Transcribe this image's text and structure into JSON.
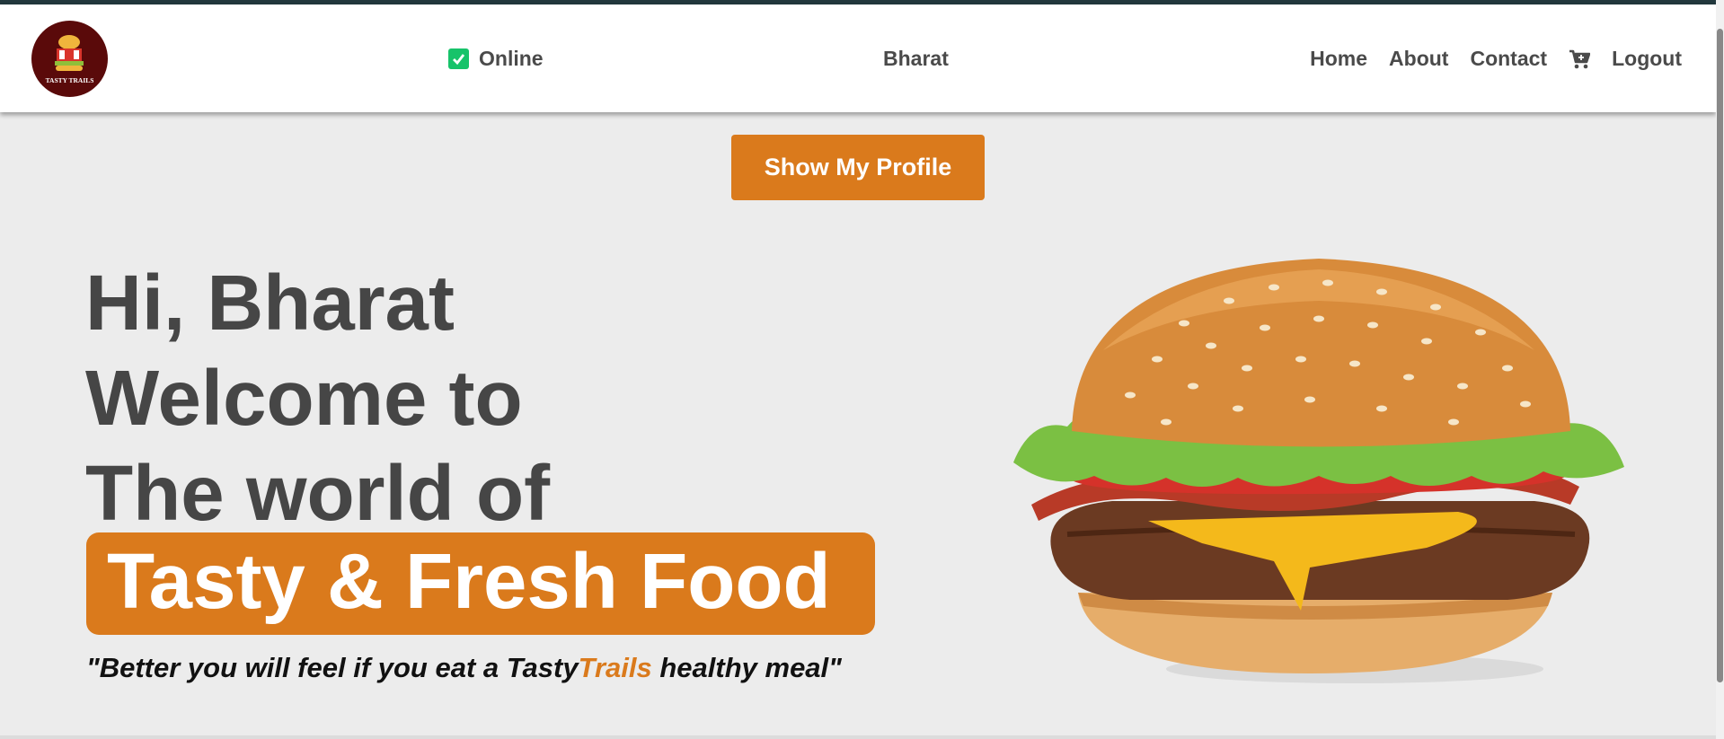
{
  "brand": {
    "logo_text": "TASTY TRAILS"
  },
  "header": {
    "status_label": "Online",
    "username": "Bharat",
    "nav": {
      "home": "Home",
      "about": "About",
      "contact": "Contact",
      "logout": "Logout"
    }
  },
  "main": {
    "profile_button": "Show My Profile",
    "greeting": "Hi, Bharat",
    "welcome": "Welcome to",
    "world_of": "The world of",
    "highlight": "Tasty & Fresh Food",
    "tagline_start": "\"Better you will feel if you eat a Tasty",
    "tagline_accent": "Trails",
    "tagline_end": " healthy meal\""
  },
  "colors": {
    "accent": "#da7a1c",
    "text_dark": "#464646",
    "status_green": "#17c36a",
    "logo_bg": "#5a0a0a"
  },
  "icons": {
    "status": "check-icon",
    "cart": "cart-icon",
    "hero": "burger-image"
  }
}
